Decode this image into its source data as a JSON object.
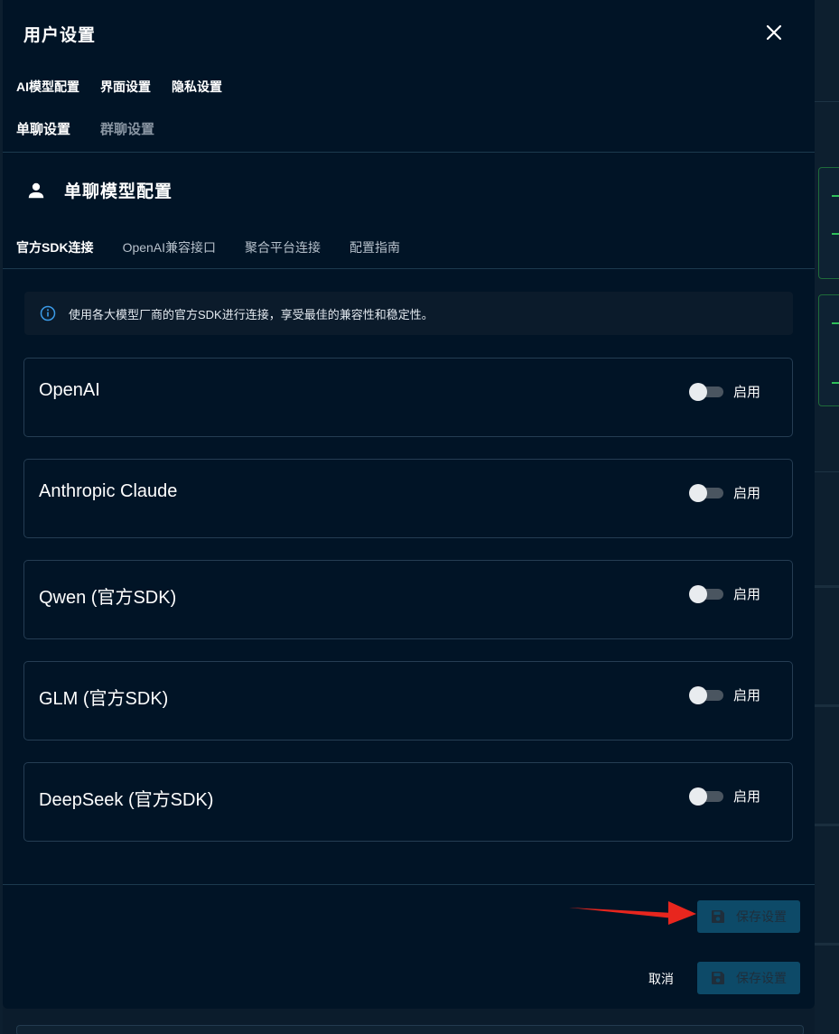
{
  "modal": {
    "title": "用户设置"
  },
  "top_tabs": [
    "AI模型配置",
    "界面设置",
    "隐私设置"
  ],
  "sub_tabs": [
    {
      "label": "单聊设置",
      "active": true
    },
    {
      "label": "群聊设置",
      "active": false
    }
  ],
  "section": {
    "title": "单聊模型配置"
  },
  "conn_tabs": [
    {
      "label": "官方SDK连接",
      "active": true
    },
    {
      "label": "OpenAI兼容接口",
      "active": false
    },
    {
      "label": "聚合平台连接",
      "active": false
    },
    {
      "label": "配置指南",
      "active": false
    }
  ],
  "info": {
    "text": "使用各大模型厂商的官方SDK进行连接，享受最佳的兼容性和稳定性。"
  },
  "providers": [
    {
      "name": "OpenAI",
      "enabled": false,
      "toggle_label": "启用"
    },
    {
      "name": "Anthropic Claude",
      "enabled": false,
      "toggle_label": "启用"
    },
    {
      "name": "Qwen (官方SDK)",
      "enabled": false,
      "toggle_label": "启用"
    },
    {
      "name": "GLM (官方SDK)",
      "enabled": false,
      "toggle_label": "启用"
    },
    {
      "name": "DeepSeek (官方SDK)",
      "enabled": false,
      "toggle_label": "启用"
    }
  ],
  "actions": {
    "save_label": "保存设置",
    "cancel_label": "取消",
    "save_footer_label": "保存设置"
  },
  "colors": {
    "modal_bg": "#011426",
    "accent_button": "#0d4a68",
    "annotation_arrow": "#e8261e"
  }
}
